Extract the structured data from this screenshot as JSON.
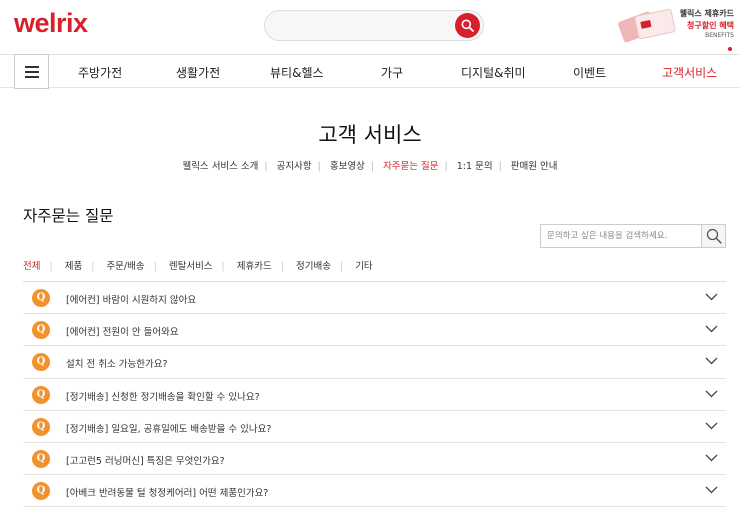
{
  "header": {
    "logo": "welrix",
    "search": {
      "placeholder": ""
    },
    "banner": {
      "line1": "웰릭스 제휴카드",
      "line2": "청구할인 혜택",
      "line3": "BENEFITS"
    }
  },
  "nav": {
    "items": [
      {
        "label": "주방가전",
        "active": false
      },
      {
        "label": "생활가전",
        "active": false
      },
      {
        "label": "뷰티&헬스",
        "active": false
      },
      {
        "label": "가구",
        "active": false
      },
      {
        "label": "디지털&취미",
        "active": false
      },
      {
        "label": "이벤트",
        "active": false
      },
      {
        "label": "고객서비스",
        "active": true
      }
    ]
  },
  "page": {
    "title": "고객 서비스",
    "sub_tabs": [
      {
        "label": "웰릭스 서비스 소개",
        "active": false
      },
      {
        "label": "공지사항",
        "active": false
      },
      {
        "label": "홍보영상",
        "active": false
      },
      {
        "label": "자주묻는 질문",
        "active": true
      },
      {
        "label": "1:1 문의",
        "active": false
      },
      {
        "label": "판매원 안내",
        "active": false
      }
    ]
  },
  "faq": {
    "title": "자주묻는 질문",
    "search_placeholder": "문의하고 싶은 내용을 검색하세요.",
    "categories": [
      {
        "label": "전체",
        "active": true
      },
      {
        "label": "제품",
        "active": false
      },
      {
        "label": "주문/배송",
        "active": false
      },
      {
        "label": "렌탈서비스",
        "active": false
      },
      {
        "label": "제휴카드",
        "active": false
      },
      {
        "label": "정기배송",
        "active": false
      },
      {
        "label": "기타",
        "active": false
      }
    ],
    "badge": "Q",
    "items": [
      "[에어컨] 바람이 시원하지 않아요",
      "[에어컨] 전원이 안 들어와요",
      "설치 전 취소 가능한가요?",
      "[정기배송] 신청한 정기배송을 확인할 수 있나요?",
      "[정기배송] 일요일, 공휴일에도 배송받을 수 있나요?",
      "[고고런5 러닝머신] 특징은 무엇인가요?",
      "[아베크 반려동물 털 청정케어러] 어떤 제품인가요?"
    ]
  },
  "colors": {
    "brand": "#d8202c",
    "badge": "#f2922f",
    "text": "#222222",
    "border": "#dddddd"
  },
  "icons": {
    "search": "search-icon",
    "menu": "hamburger-icon",
    "expand": "chevron-down-icon"
  }
}
